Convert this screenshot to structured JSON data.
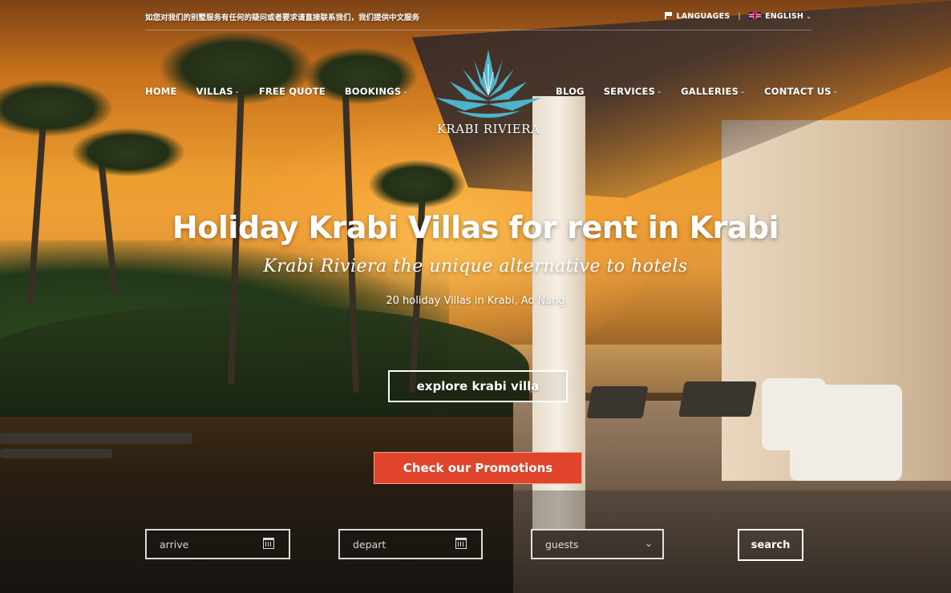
{
  "topbar": {
    "notice": "如您对我们的别墅服务有任何的疑问或者要求请直接联系我们，我们提供中文服务",
    "languages_label": "LANGUAGES",
    "separator": "|",
    "current_language": "ENGLISH"
  },
  "nav": {
    "left": [
      {
        "label": "HOME",
        "dropdown": false
      },
      {
        "label": "VILLAS",
        "dropdown": true
      },
      {
        "label": "FREE QUOTE",
        "dropdown": false
      },
      {
        "label": "BOOKINGS",
        "dropdown": true
      }
    ],
    "right": [
      {
        "label": "BLOG",
        "dropdown": false
      },
      {
        "label": "SERVICES",
        "dropdown": true
      },
      {
        "label": "GALLERIES",
        "dropdown": true
      },
      {
        "label": "CONTACT US",
        "dropdown": true
      }
    ]
  },
  "logo": {
    "text": "KRABI RIVIERA",
    "color": "#4fb3c9"
  },
  "hero": {
    "headline": "Holiday Krabi Villas for rent in Krabi",
    "tagline": "Krabi Riviera the unique alternative to hotels",
    "subline": "20 holiday Villas in Krabi, Ao Nang",
    "explore_button": "explore krabi villa",
    "promo_button": "Check our Promotions",
    "promo_color": "#e0452b"
  },
  "booking": {
    "arrive_placeholder": "arrive",
    "depart_placeholder": "depart",
    "guests_placeholder": "guests",
    "search_label": "search"
  },
  "icons": {
    "flag": "flag-icon",
    "uk_flag": "uk-flag-icon",
    "calendar": "calendar-icon",
    "chevron": "chevron-down-icon"
  }
}
